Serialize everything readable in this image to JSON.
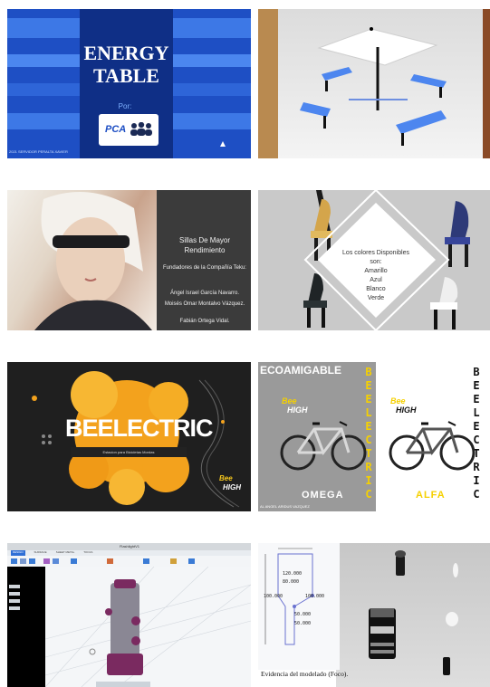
{
  "slides": {
    "energy": {
      "title_line1": "ENERGY",
      "title_line2": "TABLE",
      "by_label": "Por:",
      "logo_text": "PCA",
      "caption": "2021 SERVIDOR PERALTA XAVIER"
    },
    "sillas": {
      "title": "Sillas De Mayor Rendimiento",
      "founders_heading": "Fundadores de la Compañía Teku:",
      "founder_1": "Ángel Israel García Navarro.",
      "founder_2": "Moisés Omar Montalvo Vázquez.",
      "founder_3": "Fabián Ortega Vidal."
    },
    "colores": {
      "line1": "Los colores Disponibles",
      "line2": "son:",
      "line3": "Amarillo",
      "line4": "Azul",
      "line5": "Blanco",
      "line6": "Verde"
    },
    "beelectric": {
      "title": "BEELECTRIC",
      "subtitle": "Estacion para Bicicletas Mordas",
      "logo_line1": "Bee",
      "logo_line2": "HIGH"
    },
    "eco": {
      "heading": "ECOAMIGABLE",
      "vertical_word": "BEELECTRIC",
      "logo_line1": "Bee",
      "logo_line2": "HIGH",
      "model_1": "OMEGA",
      "model_2": "ALFA",
      "caption": "AL ANGEL ARIDUS VAZQUEZ"
    },
    "cad": {
      "tabs": [
        "DESIGN",
        "SURFACE",
        "SHEET METAL",
        "TOOLS"
      ],
      "file_title": "FlashlightV1"
    },
    "foco": {
      "caption": "Evidencia del modelado (Foco).",
      "dims": [
        "120.000",
        "80.000",
        "100.000",
        "100.000",
        "50.000",
        "50.000"
      ]
    }
  },
  "colors": {
    "energy_bg": "#1e4fc4",
    "energy_band": "#0f2f86",
    "beelectric_orange": "#f3a21d",
    "eco_yellow": "#f5d000"
  }
}
